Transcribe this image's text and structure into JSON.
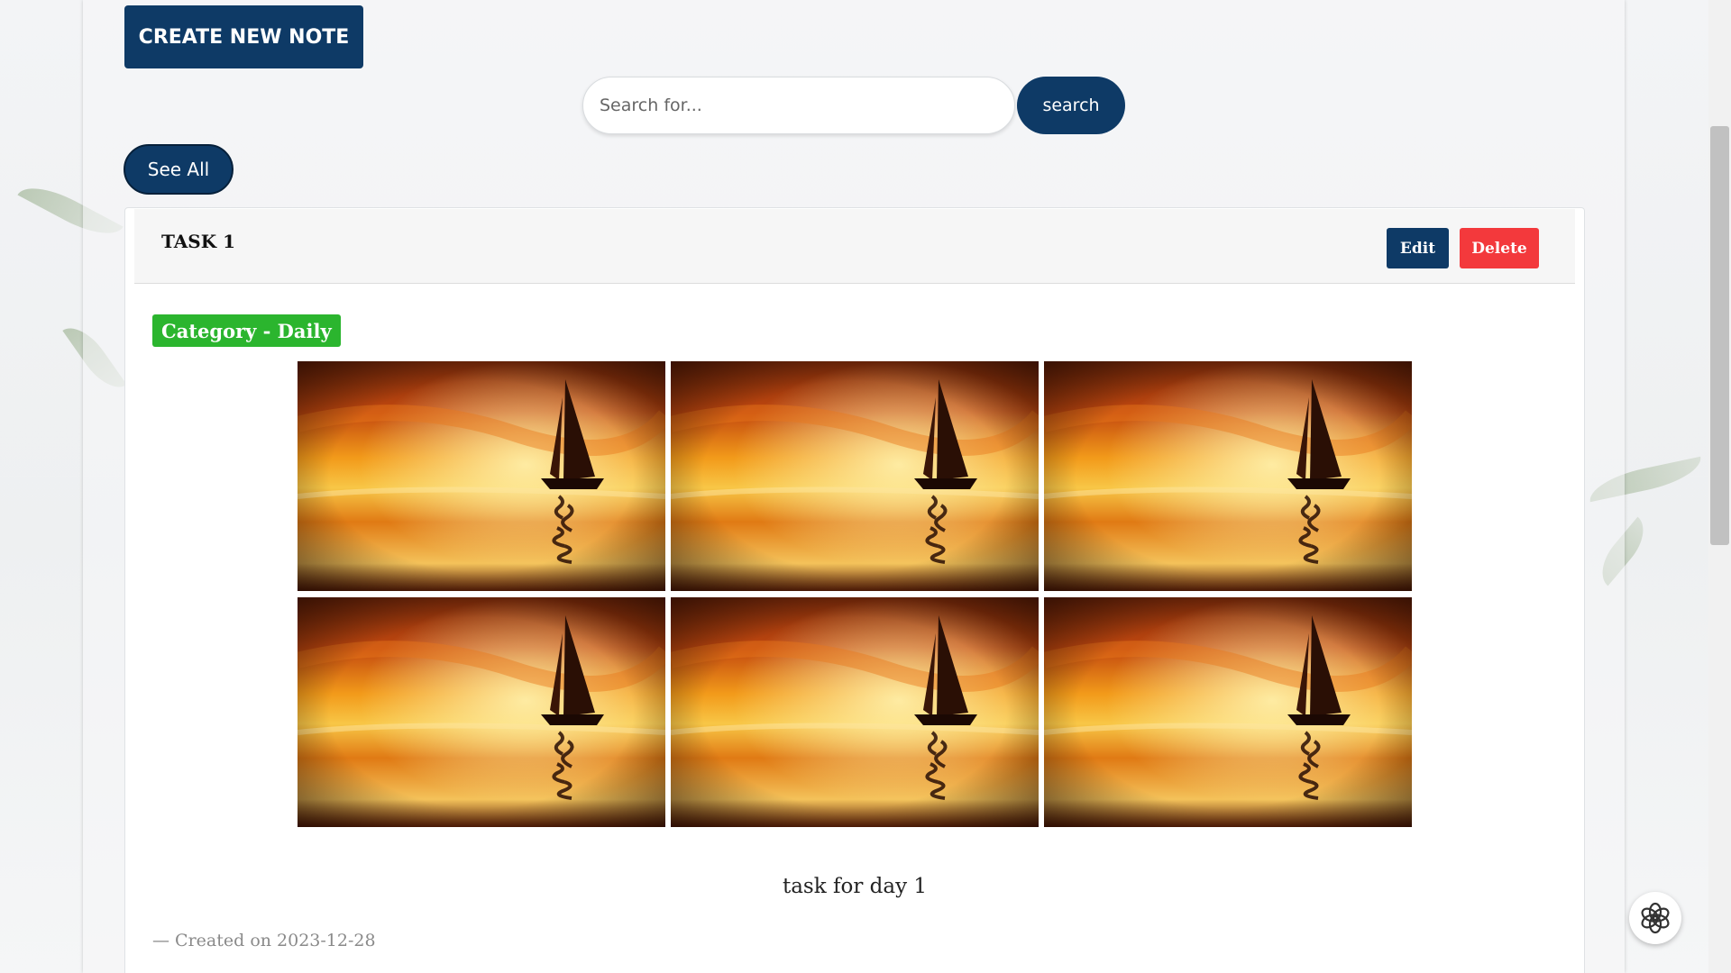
{
  "toolbar": {
    "create_label": "CREATE NEW NOTE"
  },
  "search": {
    "placeholder": "Search for...",
    "value": "",
    "button_label": "search"
  },
  "filter": {
    "see_all_label": "See All"
  },
  "note": {
    "title": "TASK 1",
    "edit_label": "Edit",
    "delete_label": "Delete",
    "category": "Category - Daily",
    "images": [
      {
        "icon": "sunset-sailboat-image"
      },
      {
        "icon": "sunset-sailboat-image"
      },
      {
        "icon": "sunset-sailboat-image"
      },
      {
        "icon": "sunset-sailboat-image"
      },
      {
        "icon": "sunset-sailboat-image"
      },
      {
        "icon": "sunset-sailboat-image"
      }
    ],
    "body": "task for day 1",
    "created": "— Created on 2023-12-28"
  },
  "colors": {
    "primary": "#0e3a66",
    "danger": "#f3393c",
    "category": "#2bb52e"
  },
  "icons": {
    "chat_fab": "assistant-logo-icon"
  }
}
